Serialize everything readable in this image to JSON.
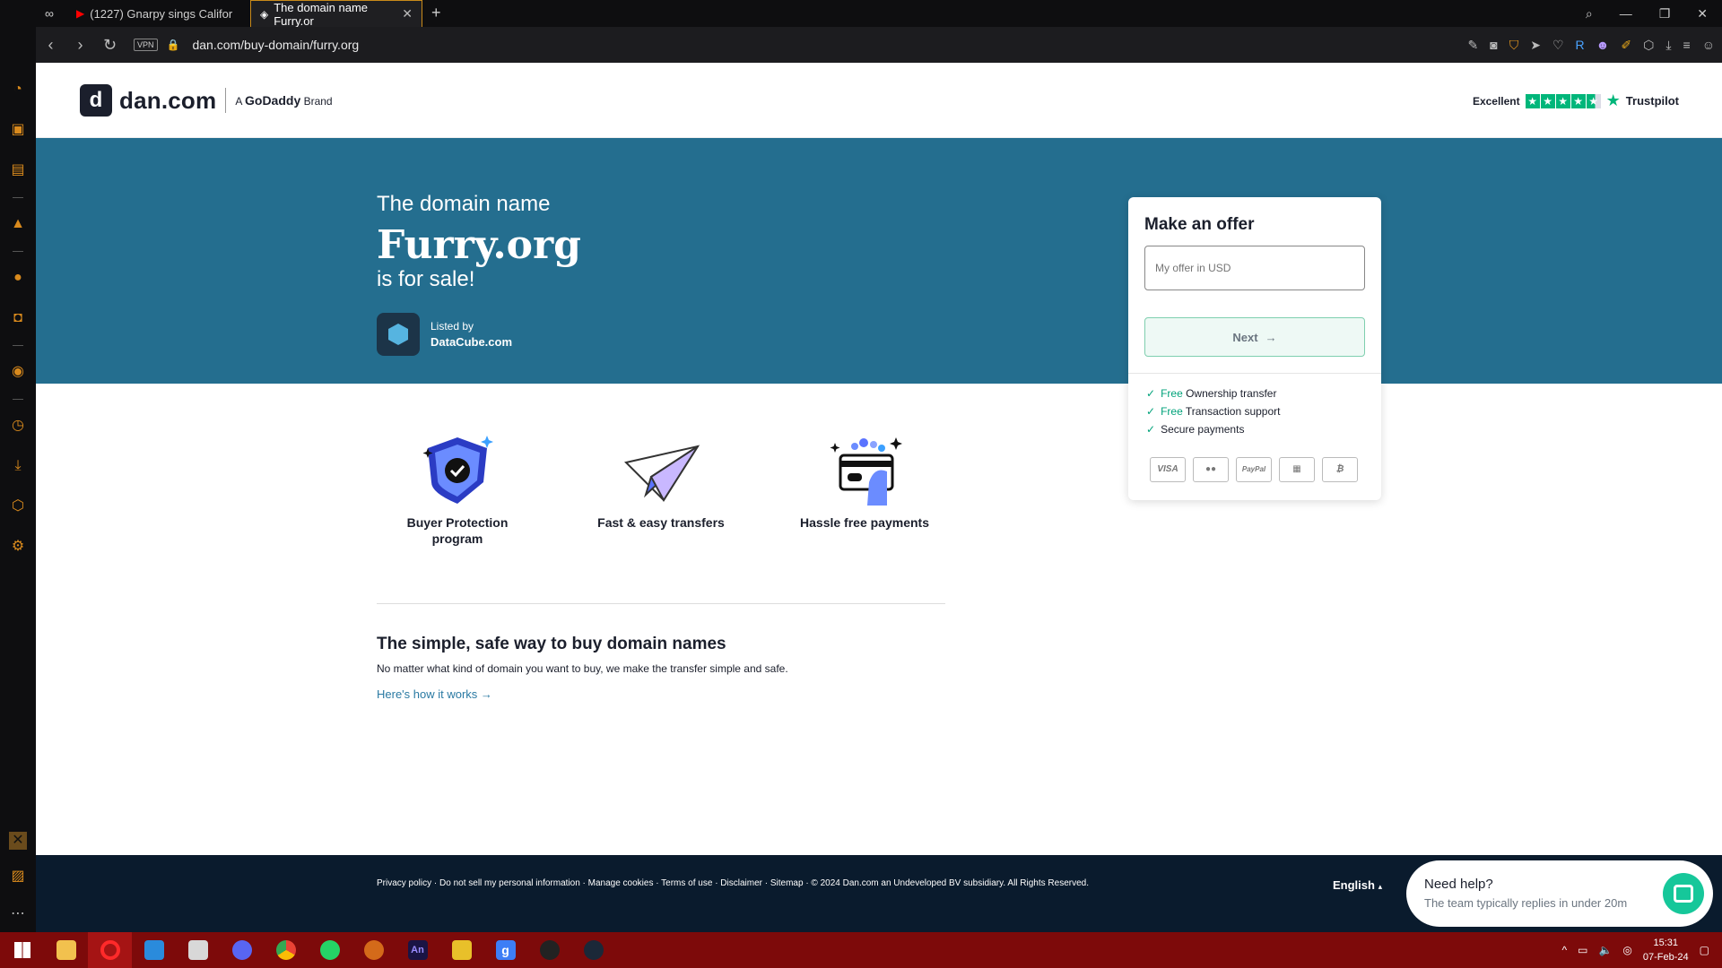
{
  "browser": {
    "tabs": [
      {
        "label": "(1227) Gnarpy sings Califor",
        "active": false
      },
      {
        "label": "The domain name Furry.or",
        "active": true
      }
    ],
    "url": "dan.com/buy-domain/furry.org",
    "vpn_label": "VPN"
  },
  "site": {
    "brand": "dan.com",
    "brand_sub_prefix": "A",
    "brand_sub_name": "GoDaddy",
    "brand_sub_suffix": "Brand",
    "trust_label": "Excellent",
    "trust_name": "Trustpilot"
  },
  "hero": {
    "pre": "The domain name",
    "domain": "Furry.org",
    "post": "is for sale!",
    "listed_by_label": "Listed by",
    "lister": "DataCube.com"
  },
  "offer": {
    "title": "Make an offer",
    "input_placeholder": "My offer in USD",
    "next_label": "Next",
    "features": [
      {
        "free": "Free",
        "text": "Ownership transfer"
      },
      {
        "free": "Free",
        "text": "Transaction support"
      },
      {
        "free": "",
        "text": "Secure payments"
      }
    ],
    "payment_icons": [
      "VISA",
      "",
      "PayPal",
      "",
      ""
    ]
  },
  "features": [
    {
      "label": "Buyer Protection program",
      "icon": "shield-icon"
    },
    {
      "label": "Fast & easy transfers",
      "icon": "paper-plane-icon"
    },
    {
      "label": "Hassle free payments",
      "icon": "card-hand-icon"
    }
  ],
  "info": {
    "heading": "The simple, safe way to buy domain names",
    "text": "No matter what kind of domain you want to buy, we make the transfer simple and safe.",
    "link": "Here's how it works"
  },
  "footer": {
    "links": "Privacy policy · Do not sell my personal information · Manage cookies · Terms of use · Disclaimer · Sitemap · © 2024 Dan.com an Undeveloped BV subsidiary. All Rights Reserved.",
    "language": "English"
  },
  "help": {
    "title": "Need help?",
    "subtitle": "The team typically replies in under 20m"
  },
  "clock": {
    "time": "15:31",
    "date": "07-Feb-24"
  },
  "colors": {
    "hero_bg": "#246e8f",
    "footer_bg": "#0a1b2d",
    "accent_green": "#00a27a",
    "taskbar": "#7d0a0a"
  }
}
